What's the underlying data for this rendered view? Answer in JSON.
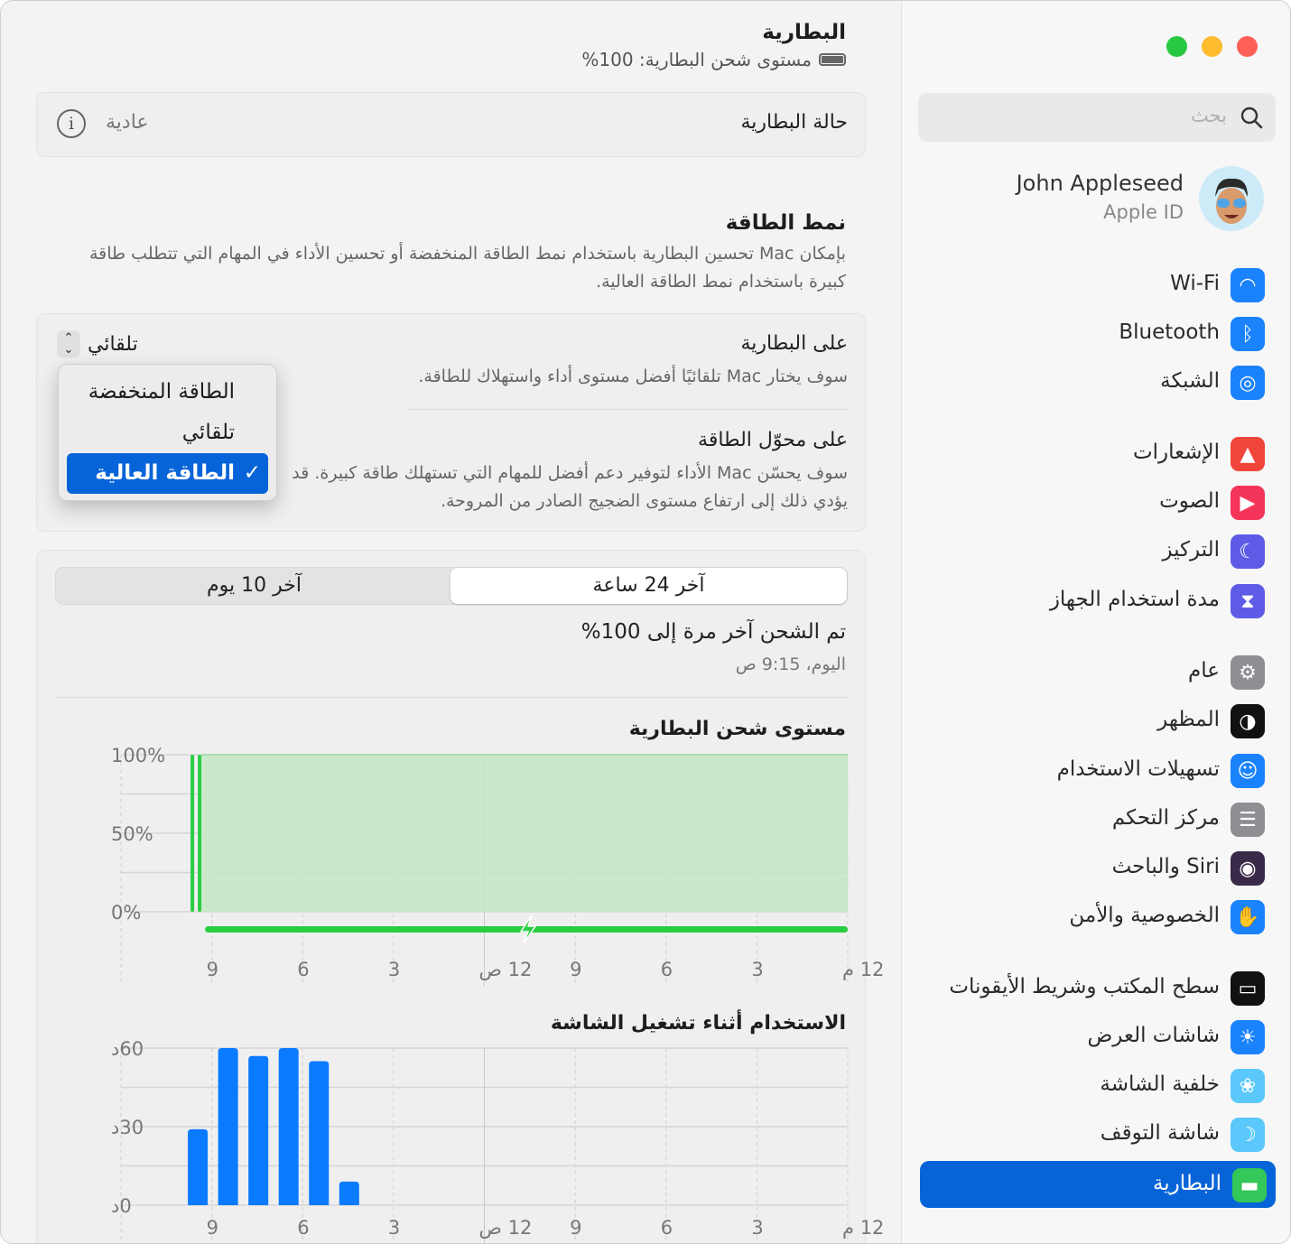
{
  "window": {
    "traffic_lights": {
      "close": "#fe5f57",
      "minimize": "#febc2e",
      "zoom": "#28c840"
    }
  },
  "sidebar": {
    "search_placeholder": "بحث",
    "user": {
      "name": "John Appleseed",
      "subtitle": "Apple ID"
    },
    "items": [
      {
        "label": "Wi-Fi",
        "icon": "wifi-icon",
        "color": "#1a82fb"
      },
      {
        "label": "Bluetooth",
        "icon": "bluetooth-icon",
        "color": "#1a82fb"
      },
      {
        "label": "الشبكة",
        "icon": "globe-icon",
        "color": "#1a82fb"
      },
      {
        "label": "الإشعارات",
        "icon": "bell-icon",
        "color": "#f0453a"
      },
      {
        "label": "الصوت",
        "icon": "speaker-icon",
        "color": "#f5345a"
      },
      {
        "label": "التركيز",
        "icon": "moon-icon",
        "color": "#5e5ce6"
      },
      {
        "label": "مدة استخدام الجهاز",
        "icon": "hourglass-icon",
        "color": "#5e5ce6"
      },
      {
        "label": "عام",
        "icon": "gear-icon",
        "color": "#8e8e93"
      },
      {
        "label": "المظهر",
        "icon": "appearance-icon",
        "color": "#111111"
      },
      {
        "label": "تسهيلات الاستخدام",
        "icon": "accessibility-icon",
        "color": "#1a82fb"
      },
      {
        "label": "مركز التحكم",
        "icon": "toggles-icon",
        "color": "#8e8e93"
      },
      {
        "label": "Siri والباحث",
        "icon": "siri-icon",
        "color": "#3a2a4a"
      },
      {
        "label": "الخصوصية والأمن",
        "icon": "hand-icon",
        "color": "#1a82fb"
      },
      {
        "label": "سطح المكتب وشريط الأيقونات",
        "icon": "dock-icon",
        "color": "#111111"
      },
      {
        "label": "شاشات العرض",
        "icon": "sun-icon",
        "color": "#1a82fb"
      },
      {
        "label": "خلفية الشاشة",
        "icon": "flower-icon",
        "color": "#5ac8fa"
      },
      {
        "label": "شاشة التوقف",
        "icon": "screensaver-icon",
        "color": "#5ac8fa"
      },
      {
        "label": "البطارية",
        "icon": "battery-icon",
        "color": "#34c759",
        "selected": true
      }
    ]
  },
  "main": {
    "title": "البطارية",
    "level_text": "مستوى شحن البطارية: 100%",
    "health": {
      "label": "حالة البطارية",
      "value": "عادية"
    },
    "energy_mode": {
      "title": "نمط الطاقة",
      "description": "بإمكان Mac تحسين البطارية باستخدام نمط الطاقة المنخفضة أو تحسين الأداء في المهام التي تتطلب طاقة كبيرة باستخدام نمط الطاقة العالية.",
      "on_battery": {
        "title": "على البطارية",
        "description": "سوف يختار Mac تلقائيًا أفضل مستوى أداء واستهلاك للطاقة.",
        "value": "تلقائي"
      },
      "on_adapter": {
        "title": "على محوّل الطاقة",
        "description": "سوف يحسّن Mac الأداء لتوفير دعم أفضل للمهام التي تستهلك طاقة كبيرة. قد يؤدي ذلك إلى ارتفاع مستوى الضجيج الصادر من المروحة."
      },
      "menu": {
        "options": [
          "الطاقة المنخفضة",
          "تلقائي",
          "الطاقة العالية"
        ],
        "selected": "الطاقة العالية"
      }
    },
    "tabs": [
      {
        "label": "آخر 24 ساعة",
        "active": true
      },
      {
        "label": "آخر 10 يوم",
        "active": false
      }
    ],
    "last_charged": {
      "title": "تم الشحن آخر مرة إلى 100%",
      "time": "اليوم، 9:15 ص"
    }
  },
  "chart_data": [
    {
      "type": "area",
      "title": "مستوى شحن البطارية",
      "y_ticks": [
        "100%",
        "50%",
        "0%"
      ],
      "ylim": [
        0,
        100
      ],
      "x_ticks": [
        "12 م",
        "3",
        "6",
        "9",
        "12 ص",
        "3",
        "6",
        "9"
      ],
      "hourly_level": [
        null,
        null,
        100,
        100,
        100,
        100,
        100,
        100,
        100,
        100,
        100,
        100,
        100,
        100,
        100,
        100,
        100,
        100,
        100,
        100,
        100,
        100,
        100,
        100
      ],
      "charging": true,
      "color": "#28cd41",
      "fill": "#c3e8c4",
      "grid": true
    },
    {
      "type": "bar",
      "title": "الاستخدام أثناء تشغيل الشاشة",
      "y_ticks": [
        "60د",
        "30د",
        "0د"
      ],
      "ylim": [
        0,
        60
      ],
      "x_ticks": [
        "12 م",
        "3",
        "6",
        "9",
        "12 ص",
        "3",
        "6",
        "9"
      ],
      "hourly_values": [
        0,
        0,
        29,
        60,
        57,
        60,
        55,
        9,
        0,
        0,
        0,
        0,
        0,
        0,
        0,
        0,
        0,
        0,
        0,
        0,
        0,
        0,
        0,
        0
      ],
      "color": "#0a7aff",
      "grid": true
    }
  ]
}
